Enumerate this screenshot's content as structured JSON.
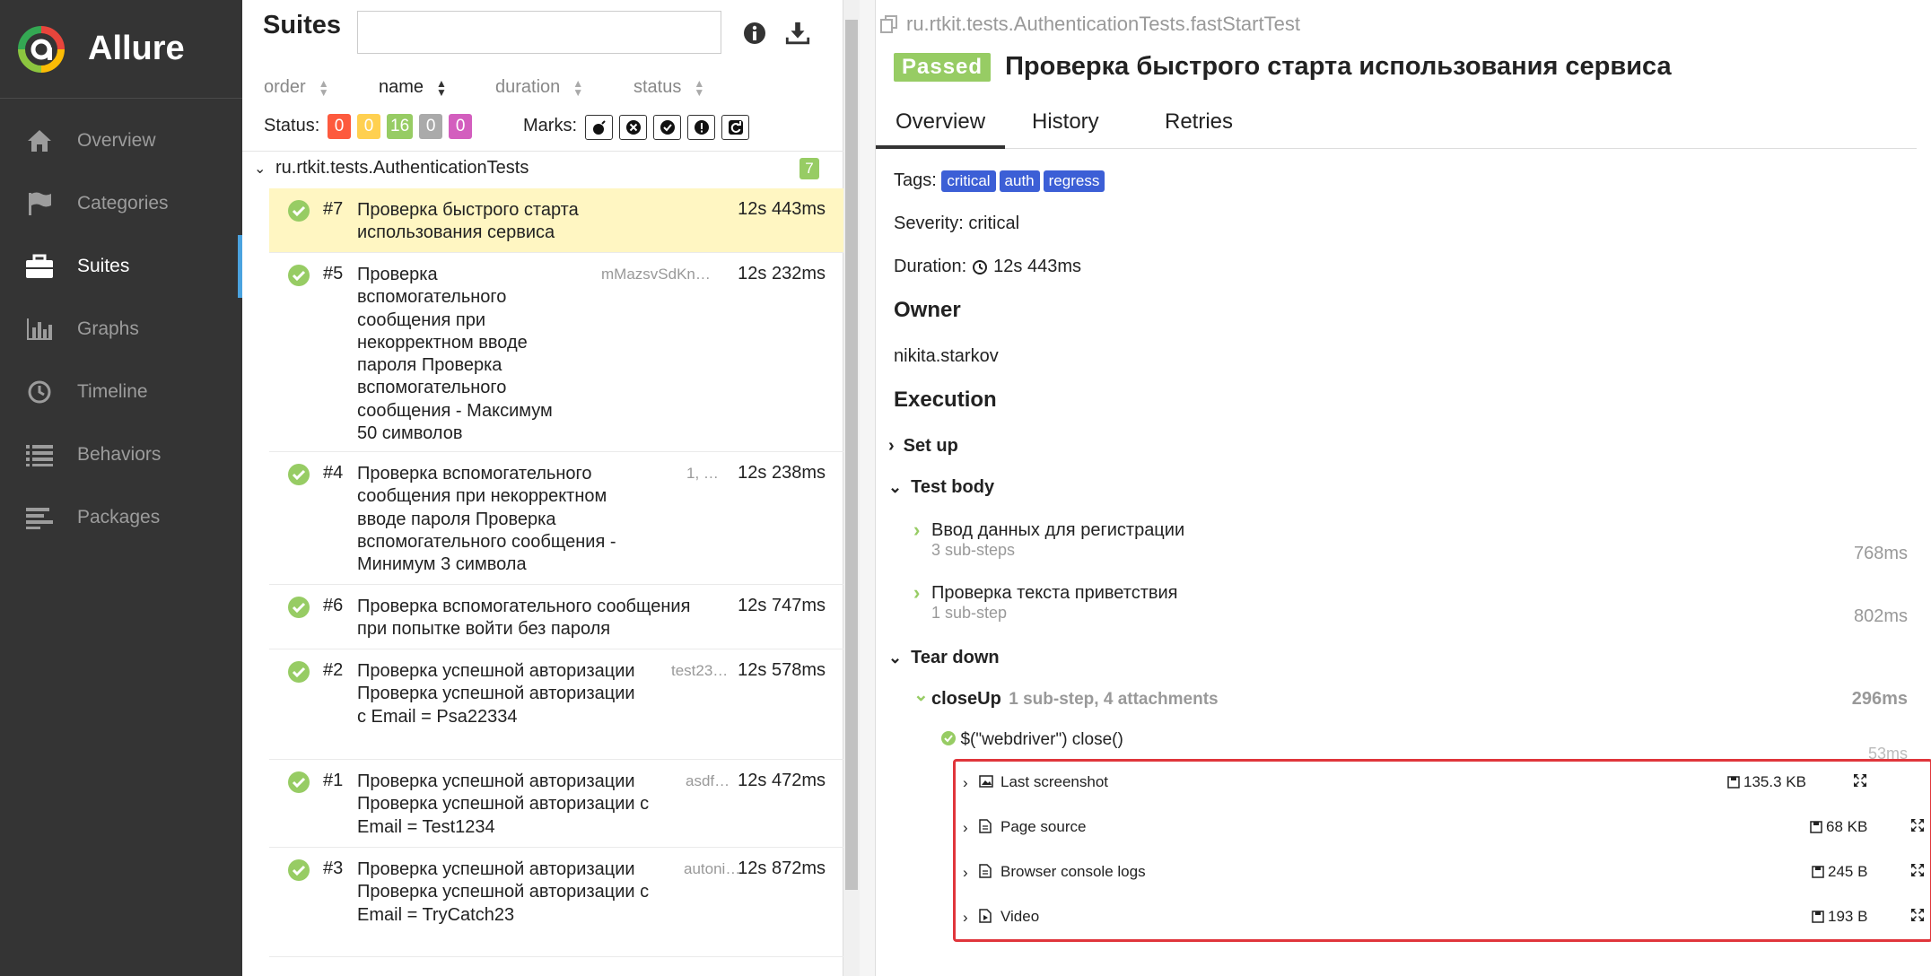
{
  "sidebar": {
    "brand": "Allure",
    "items": [
      {
        "label": "Overview",
        "icon": "home-icon"
      },
      {
        "label": "Categories",
        "icon": "flag-icon"
      },
      {
        "label": "Suites",
        "icon": "briefcase-icon",
        "active": true
      },
      {
        "label": "Graphs",
        "icon": "bar-chart-icon"
      },
      {
        "label": "Timeline",
        "icon": "clock-icon"
      },
      {
        "label": "Behaviors",
        "icon": "list-icon"
      },
      {
        "label": "Packages",
        "icon": "align-left-icon"
      }
    ]
  },
  "suites": {
    "title": "Suites",
    "search_value": "",
    "sort": {
      "order": "order",
      "name": "name",
      "duration": "duration",
      "status": "status"
    },
    "status_label": "Status:",
    "status_counts": {
      "failed": "0",
      "broken": "0",
      "passed": "16",
      "skipped": "0",
      "unknown": "0"
    },
    "marks_label": "Marks:",
    "group": {
      "name": "ru.rtkit.tests.AuthenticationTests",
      "count": "7"
    },
    "tests": [
      {
        "num": "#7",
        "name": "Проверка быстрого старта использования сервиса",
        "params": "",
        "duration": "12s 443ms"
      },
      {
        "num": "#5",
        "name": "Проверка вспомогательного сообщения при некорректном вводе пароля Проверка вспомогательного сообщения - Максимум 50 символов",
        "params": "mMazsvSdKn…",
        "duration": "12s 232ms"
      },
      {
        "num": "#4",
        "name": "Проверка вспомогательного сообщения при некорректном вводе пароля Проверка вспомогательного сообщения - Минимум 3 символа",
        "params": "1, …",
        "duration": "12s 238ms"
      },
      {
        "num": "#6",
        "name": "Проверка вспомогательного сообщения при попытке войти без пароля",
        "params": "",
        "duration": "12s 747ms"
      },
      {
        "num": "#2",
        "name": "Проверка успешной авторизации Проверка успешной авторизации с Email = Psa22334",
        "params": "test23…",
        "duration": "12s 578ms"
      },
      {
        "num": "#1",
        "name": "Проверка успешной авторизации Проверка успешной авторизации с Email = Test1234",
        "params": "asdf…",
        "duration": "12s 472ms"
      },
      {
        "num": "#3",
        "name": "Проверка успешной авторизации Проверка успешной авторизации с Email = TryCatch23",
        "params": "autoni…",
        "duration": "12s 872ms"
      }
    ]
  },
  "result": {
    "fullname": "ru.rtkit.tests.AuthenticationTests.fastStartTest",
    "status": "Passed",
    "title": "Проверка быстрого старта использования сервиса",
    "tabs": [
      "Overview",
      "History",
      "Retries"
    ],
    "tags_label": "Tags:",
    "tags": [
      "critical",
      "auth",
      "regress"
    ],
    "severity": "Severity: critical",
    "duration_label": "Duration:",
    "duration": "12s 443ms",
    "owner_heading": "Owner",
    "owner": "nikita.starkov",
    "execution_heading": "Execution",
    "setup": "Set up",
    "test_body": "Test body",
    "steps": [
      {
        "name": "Ввод данных для регистрации",
        "sub": "3 sub-steps",
        "duration": "768ms"
      },
      {
        "name": "Проверка текста приветствия",
        "sub": "1 sub-step",
        "duration": "802ms"
      }
    ],
    "teardown": "Tear down",
    "closeup": {
      "name": "closeUp",
      "meta": "1 sub-step, 4 attachments",
      "duration": "296ms"
    },
    "substep": {
      "name": "$(\"webdriver\") close()",
      "duration": "53ms"
    },
    "attachments": [
      {
        "name": "Last screenshot",
        "size": "135.3 KB",
        "icon": "image-icon"
      },
      {
        "name": "Page source",
        "size": "68 KB",
        "icon": "file-icon"
      },
      {
        "name": "Browser console logs",
        "size": "245 B",
        "icon": "file-icon"
      },
      {
        "name": "Video",
        "size": "193 B",
        "icon": "video-file-icon"
      }
    ]
  }
}
